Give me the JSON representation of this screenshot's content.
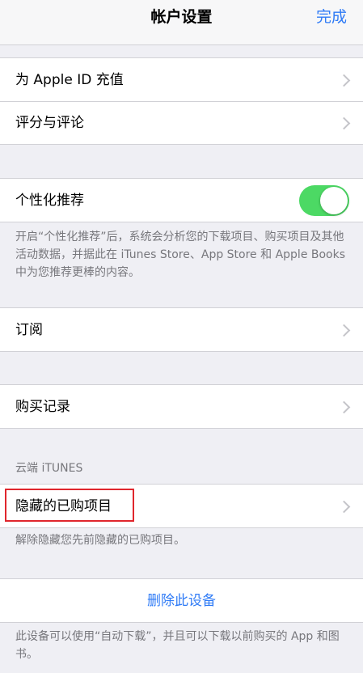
{
  "nav": {
    "title": "帐户设置",
    "done": "完成"
  },
  "group1": {
    "items": [
      {
        "label": "为 Apple ID 充值"
      },
      {
        "label": "评分与评论"
      }
    ]
  },
  "personalization": {
    "label": "个性化推荐",
    "toggle_on": true,
    "footnote": "开启“个性化推荐”后，系统会分析您的下载项目、购买项目及其他活动数据，并据此在 iTunes Store、App Store 和 Apple Books 中为您推荐更棒的内容。"
  },
  "subscriptions": {
    "label": "订阅"
  },
  "purchase_history": {
    "label": "购买记录"
  },
  "cloud": {
    "header": "云端 iTUNES",
    "hidden_purchases": "隐藏的已购项目",
    "footnote": "解除隐藏您先前隐藏的已购项目。"
  },
  "device": {
    "remove": "删除此设备",
    "footnote": "此设备可以使用“自动下载”，并且可以下载以前购买的 App 和图书。"
  },
  "colors": {
    "accent": "#2f7bf6",
    "toggle": "#4cd964",
    "highlight": "#e0262d"
  }
}
